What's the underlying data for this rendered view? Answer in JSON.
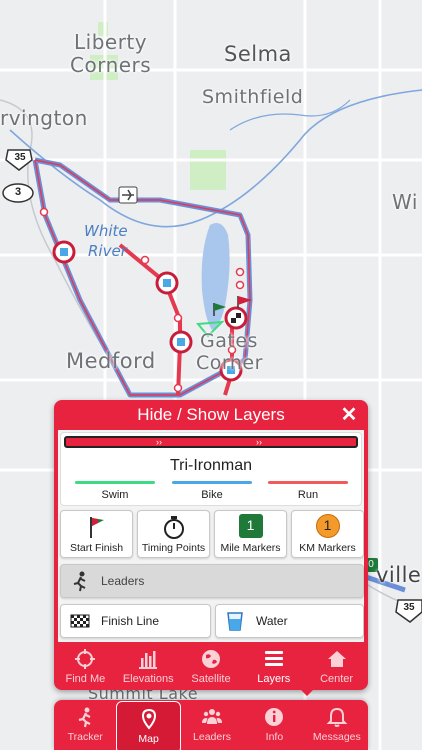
{
  "map": {
    "places": [
      {
        "name": "Liberty",
        "cls": "p-liberty"
      },
      {
        "name": "Corners",
        "cls": "p-corners"
      },
      {
        "name": "Selma",
        "cls": "p-selma"
      },
      {
        "name": "Smithfield",
        "cls": "p-smithfield"
      },
      {
        "name": "rvington",
        "cls": "p-irvington"
      },
      {
        "name": "Wi",
        "cls": "p-wi"
      },
      {
        "name": "Medford",
        "cls": "p-medford"
      },
      {
        "name": "Gates",
        "cls": "p-gates"
      },
      {
        "name": "Corner",
        "cls": "p-corner"
      },
      {
        "name": "ville",
        "cls": "p-ville"
      },
      {
        "name": "Summit Lake",
        "cls": "p-summit"
      }
    ],
    "water_labels": [
      "White",
      "River"
    ],
    "shields": {
      "us35_top": "35",
      "road3": "3",
      "us35_bottom": "35"
    },
    "marker_label": "0"
  },
  "layers_panel": {
    "title": "Hide / Show Layers",
    "close_icon": "close-icon",
    "route": {
      "name": "Tri-Ironman",
      "legs": [
        {
          "label": "Swim",
          "color": "#3ddc84"
        },
        {
          "label": "Bike",
          "color": "#4aa8e8"
        },
        {
          "label": "Run",
          "color": "#f05a5a"
        }
      ],
      "strip_marks": [
        "››",
        "››"
      ]
    },
    "tiles": [
      {
        "label": "Start Finish",
        "icon": "start-flag-icon"
      },
      {
        "label": "Timing Points",
        "icon": "stopwatch-icon"
      },
      {
        "label": "Mile Markers",
        "icon": "mile-marker-icon",
        "badge": "1"
      },
      {
        "label": "KM Markers",
        "icon": "km-marker-icon",
        "badge": "1"
      }
    ],
    "leaders": {
      "label": "Leaders",
      "icon": "runner-icon"
    },
    "finish_line": {
      "label": "Finish Line",
      "icon": "checkered-flag-icon"
    },
    "water": {
      "label": "Water",
      "icon": "water-cup-icon"
    },
    "tabs": [
      {
        "label": "Find Me",
        "icon": "crosshair-icon"
      },
      {
        "label": "Elevations",
        "icon": "elevation-chart-icon"
      },
      {
        "label": "Satellite",
        "icon": "globe-icon"
      },
      {
        "label": "Layers",
        "icon": "layers-icon",
        "active": true
      },
      {
        "label": "Center",
        "icon": "home-icon"
      }
    ]
  },
  "bottom_nav": [
    {
      "label": "Tracker",
      "icon": "runner-icon"
    },
    {
      "label": "Map",
      "icon": "map-pin-icon",
      "active": true
    },
    {
      "label": "Leaders",
      "icon": "group-icon"
    },
    {
      "label": "Info",
      "icon": "info-icon"
    },
    {
      "label": "Messages",
      "icon": "bell-icon"
    }
  ],
  "colors": {
    "accent": "#e7233f",
    "route_red": "#e53950",
    "route_blue": "#6a8fd8",
    "lake": "#a9c6ec",
    "park": "#cfeec4"
  }
}
